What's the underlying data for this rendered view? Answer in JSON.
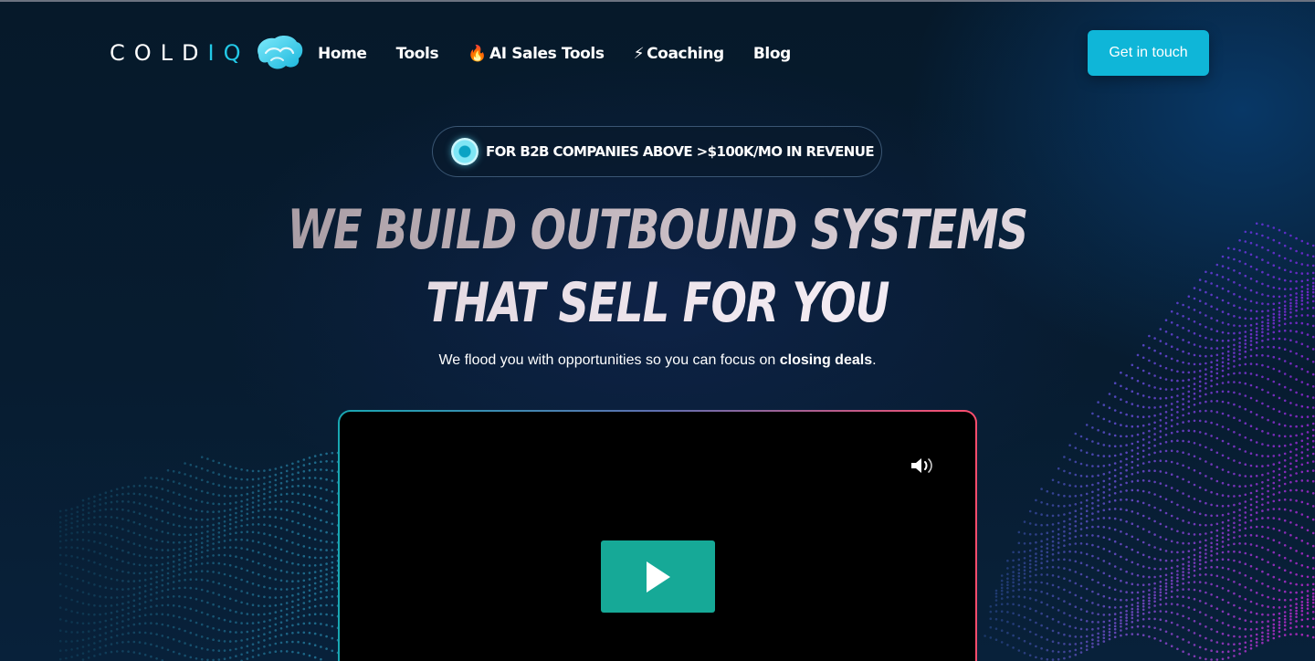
{
  "header": {
    "logo": {
      "text_main": "COLD",
      "text_accent": "IQ"
    },
    "nav": [
      {
        "label": "Home",
        "emoji": ""
      },
      {
        "label": "Tools",
        "emoji": ""
      },
      {
        "label": "AI Sales Tools",
        "emoji": "🔥"
      },
      {
        "label": "Coaching",
        "emoji": "⚡"
      },
      {
        "label": "Blog",
        "emoji": ""
      }
    ],
    "cta_label": "Get in touch"
  },
  "hero": {
    "badge": "FOR B2B COMPANIES ABOVE >$100K/MO IN REVENUE",
    "headline_line1": "WE BUILD OUTBOUND SYSTEMS",
    "headline_line2": "THAT SELL FOR YOU",
    "subhead_prefix": "We flood you with opportunities so you can focus on ",
    "subhead_bold": "closing deals",
    "subhead_suffix": "."
  },
  "video": {
    "volume_icon": "speaker-volume-icon",
    "play_icon": "play-icon",
    "play_button_color": "#16a997"
  },
  "colors": {
    "accent": "#0fb6d8",
    "logo_accent": "#22c8e6",
    "background": "#061a2c"
  }
}
